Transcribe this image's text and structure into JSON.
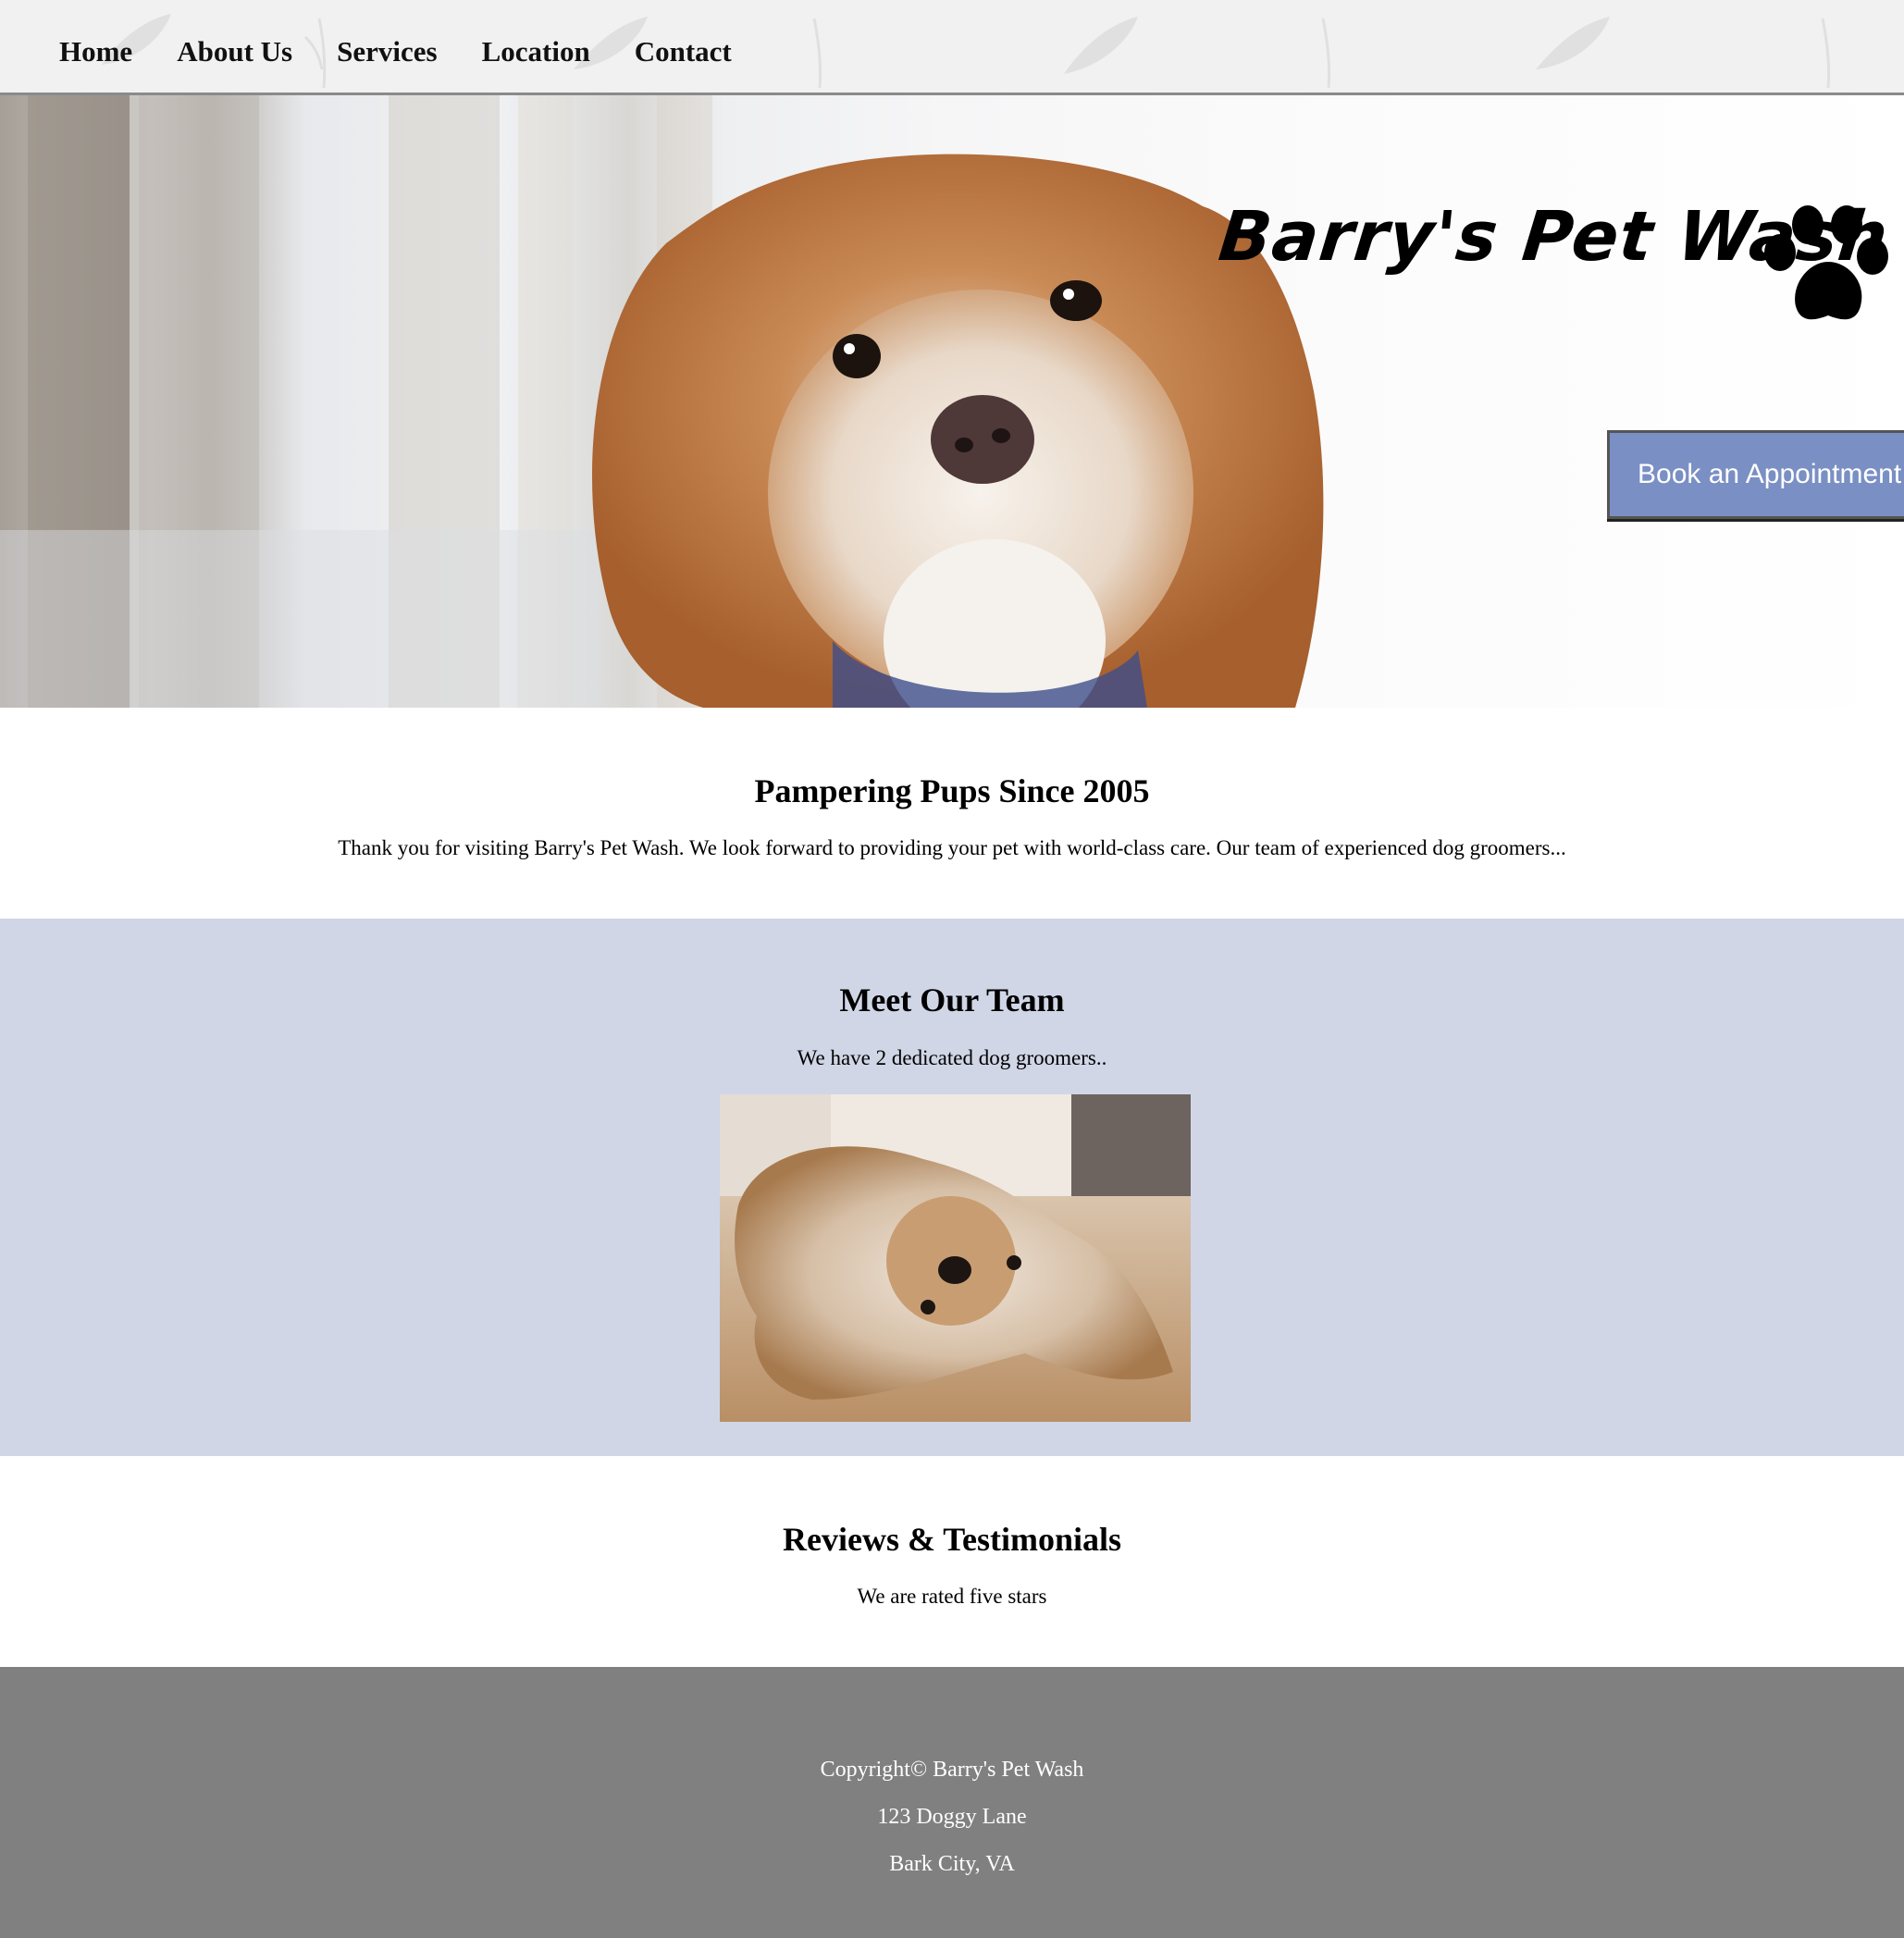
{
  "nav": {
    "items": [
      {
        "label": "Home"
      },
      {
        "label": "About Us"
      },
      {
        "label": "Services"
      },
      {
        "label": "Location"
      },
      {
        "label": "Contact"
      }
    ]
  },
  "hero": {
    "brand": "Barry's Pet Wash",
    "logo_icon": "paw-icon",
    "cta_label": "Book an Appointment",
    "cta_color": "#7a8fc3"
  },
  "about": {
    "title": "Pampering Pups Since 2005",
    "text": "Thank you for visiting Barry's Pet Wash. We look forward to providing your pet with world-class care. Our team of experienced dog groomers..."
  },
  "team": {
    "title": "Meet Our Team",
    "text": "We have 2 dedicated dog groomers..",
    "background": "#d0d6e6"
  },
  "reviews": {
    "title": "Reviews & Testimonials",
    "text": "We are rated five stars"
  },
  "footer": {
    "copyright": "Copyright© Barry's Pet Wash",
    "address_line1": "123 Doggy Lane",
    "address_line2": "Bark City, VA",
    "background": "#808080"
  }
}
